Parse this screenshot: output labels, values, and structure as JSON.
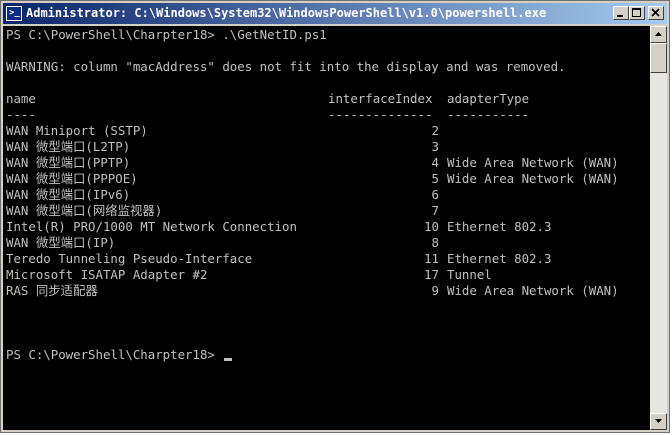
{
  "window": {
    "title": "Administrator: C:\\Windows\\System32\\WindowsPowerShell\\v1.0\\powershell.exe",
    "icon_glyph": ">_",
    "icon_name": "powershell-icon",
    "colors": {
      "console_bg": "#000000",
      "console_fg": "#c0c0c0",
      "titlebar_start": "#0a246a",
      "titlebar_end": "#a6caf0"
    }
  },
  "console": {
    "command_line": "PS C:\\PowerShell\\Charpter18> .\\GetNetID.ps1",
    "warning": "WARNING: column \"macAddress\" does not fit into the display and was removed.",
    "headers": {
      "name": "name",
      "interfaceIndex": "interfaceIndex",
      "adapterType": "adapterType"
    },
    "separators": {
      "name": "----",
      "interfaceIndex": "--------------",
      "adapterType": "-----------"
    },
    "rows": [
      {
        "name": "WAN Miniport (SSTP)",
        "interfaceIndex": "2",
        "adapterType": ""
      },
      {
        "name": "WAN 微型端口(L2TP)",
        "interfaceIndex": "3",
        "adapterType": ""
      },
      {
        "name": "WAN 微型端口(PPTP)",
        "interfaceIndex": "4",
        "adapterType": "Wide Area Network (WAN)"
      },
      {
        "name": "WAN 微型端口(PPPOE)",
        "interfaceIndex": "5",
        "adapterType": "Wide Area Network (WAN)"
      },
      {
        "name": "WAN 微型端口(IPv6)",
        "interfaceIndex": "6",
        "adapterType": ""
      },
      {
        "name": "WAN 微型端口(网络监视器)",
        "interfaceIndex": "7",
        "adapterType": ""
      },
      {
        "name": "Intel(R) PRO/1000 MT Network Connection",
        "interfaceIndex": "10",
        "adapterType": "Ethernet 802.3"
      },
      {
        "name": "WAN 微型端口(IP)",
        "interfaceIndex": "8",
        "adapterType": ""
      },
      {
        "name": "Teredo Tunneling Pseudo-Interface",
        "interfaceIndex": "11",
        "adapterType": "Ethernet 802.3"
      },
      {
        "name": "Microsoft ISATAP Adapter #2",
        "interfaceIndex": "17",
        "adapterType": "Tunnel"
      },
      {
        "name": "RAS 同步适配器",
        "interfaceIndex": "9",
        "adapterType": "Wide Area Network (WAN)"
      }
    ],
    "prompt": "PS C:\\PowerShell\\Charpter18> "
  }
}
